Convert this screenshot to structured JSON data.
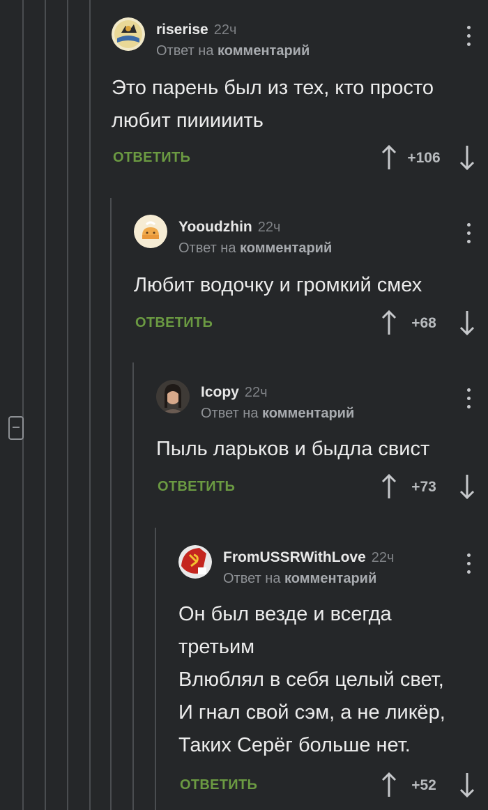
{
  "collapse_control": {
    "label": "collapse-thread"
  },
  "comments": [
    {
      "author": "riserise",
      "time": "22ч",
      "reply_prefix": "Ответ на",
      "reply_target": "комментарий",
      "text": "Это парень был из тех, кто просто\nлюбит пииииить",
      "reply_label": "ОТВЕТИТЬ",
      "score": "+106"
    },
    {
      "author": "Yooudzhin",
      "time": "22ч",
      "reply_prefix": "Ответ на",
      "reply_target": "комментарий",
      "text": "Любит водочку и громкий смех",
      "reply_label": "ОТВЕТИТЬ",
      "score": "+68"
    },
    {
      "author": "Icopy",
      "time": "22ч",
      "reply_prefix": "Ответ на",
      "reply_target": "комментарий",
      "text": "Пыль ларьков и быдла свист",
      "reply_label": "ОТВЕТИТЬ",
      "score": "+73"
    },
    {
      "author": "FromUSSRWithLove",
      "time": "22ч",
      "reply_prefix": "Ответ на",
      "reply_target": "комментарий",
      "text": "Он был везде и всегда\nтретьим\nВлюблял в себя целый свет,\nИ гнал свой сэм, а не ликёр,\nТаких Серёг больше нет.",
      "reply_label": "ОТВЕТИТЬ",
      "score": "+52"
    }
  ],
  "icons": {
    "upvote": "arrow-up-icon",
    "downvote": "arrow-down-icon",
    "menu": "more-vertical-icon",
    "collapse": "minus-box-icon"
  },
  "colors": {
    "background": "#252729",
    "reply_green": "#6b9a42",
    "thread_line": "#4a4d50"
  }
}
